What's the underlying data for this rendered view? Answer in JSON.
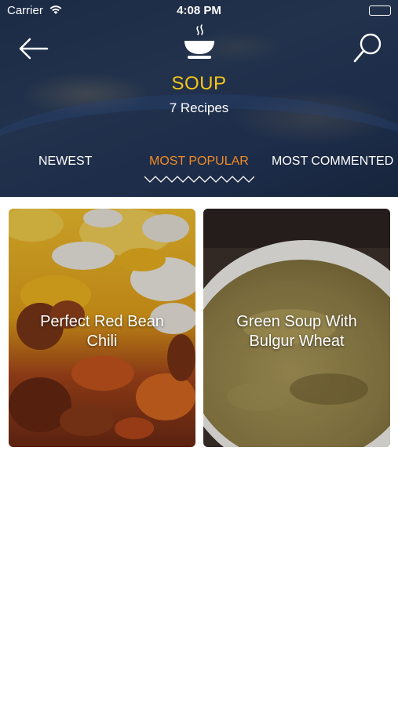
{
  "status_bar": {
    "carrier": "Carrier",
    "time": "4:08 PM"
  },
  "header": {
    "back_icon": "arrow-left-icon",
    "category_icon": "steaming-bowl-icon",
    "search_icon": "search-icon",
    "title": "SOUP",
    "subtitle": "7 Recipes",
    "title_color": "#f5c518"
  },
  "tabs": [
    {
      "label": "NEWEST",
      "active": false
    },
    {
      "label": "MOST POPULAR",
      "active": true
    },
    {
      "label": "MOST COMMENTED",
      "active": false
    }
  ],
  "accent_color": "#f08a24",
  "recipes": [
    {
      "title": "Perfect Red Bean Chili"
    },
    {
      "title": "Green Soup With Bulgur Wheat"
    }
  ]
}
